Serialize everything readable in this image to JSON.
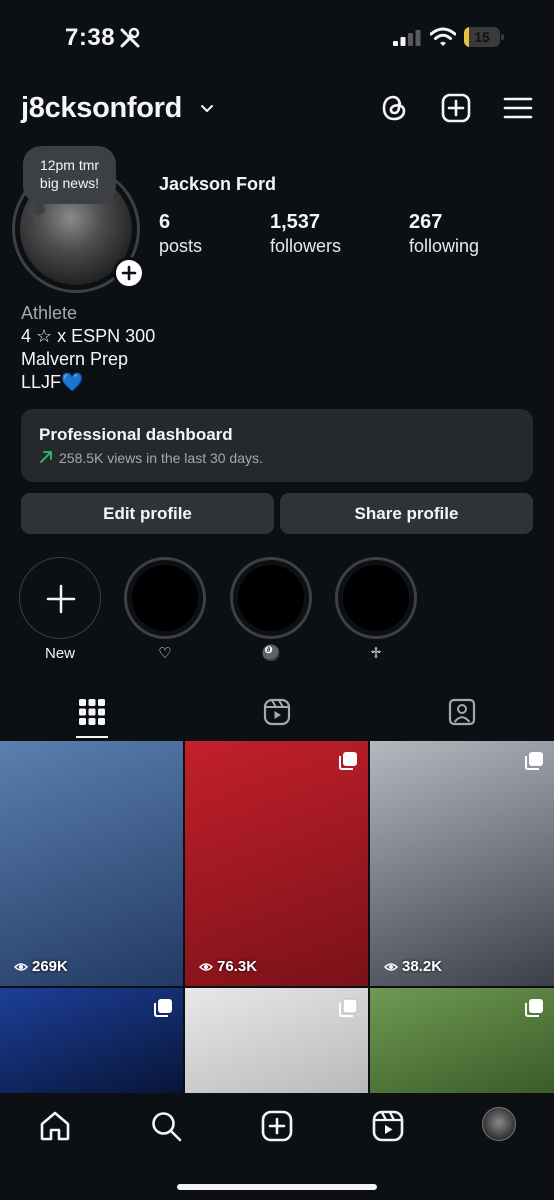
{
  "status": {
    "time": "7:38",
    "battery": "15",
    "battery_level": 0.15
  },
  "header": {
    "username": "j8cksonford"
  },
  "profile": {
    "note": [
      "12pm tmr",
      "big news!"
    ],
    "display_name": "Jackson Ford",
    "stats": [
      {
        "value": "6",
        "label": "posts"
      },
      {
        "value": "1,537",
        "label": "followers"
      },
      {
        "value": "267",
        "label": "following"
      }
    ],
    "bio": {
      "category": "Athlete",
      "lines": [
        "4 ☆ x ESPN 300",
        "Malvern Prep",
        "LLJF💙"
      ]
    }
  },
  "dashboard": {
    "title": "Professional dashboard",
    "subtitle": "258.5K views in the last 30 days."
  },
  "buttons": {
    "edit": "Edit profile",
    "share": "Share profile"
  },
  "highlights": [
    {
      "label": "New"
    },
    {
      "label": "♡"
    },
    {
      "label": "🎱"
    },
    {
      "label": "♱"
    }
  ],
  "tabs": [
    "posts-grid",
    "reels",
    "tagged"
  ],
  "grid": [
    {
      "views": "269K",
      "colors": [
        "#5b7fb0",
        "#223a63"
      ],
      "multi": false
    },
    {
      "views": "76.3K",
      "colors": [
        "#c3202b",
        "#7a1118"
      ],
      "multi": true
    },
    {
      "views": "38.2K",
      "colors": [
        "#b5b8bf",
        "#3b3f4a"
      ],
      "multi": true
    },
    {
      "views": "",
      "colors": [
        "#1d3f9a",
        "#071537"
      ],
      "multi": true
    },
    {
      "views": "",
      "colors": [
        "#e8e8e8",
        "#b9b9b9"
      ],
      "multi": true
    },
    {
      "views": "",
      "colors": [
        "#6f9a52",
        "#3a5b2a"
      ],
      "multi": true
    }
  ],
  "colors": {
    "background": "#0c1014",
    "card": "#25292e",
    "button": "#2f3338",
    "accent_green": "#2fbf71"
  }
}
